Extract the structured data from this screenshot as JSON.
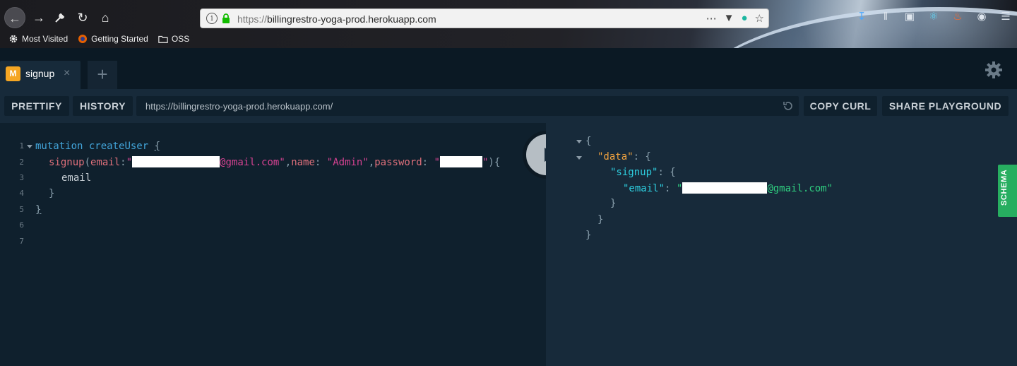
{
  "browser": {
    "url": "https://billingrestro-yoga-prod.herokuapp.com",
    "url_host_prefix": "https://",
    "url_host": "billingrestro-yoga-prod.herokuapp.com",
    "bookmarks": [
      {
        "label": "Most Visited",
        "icon": "gear-icon"
      },
      {
        "label": "Getting Started",
        "icon": "firefox-icon"
      },
      {
        "label": "OSS",
        "icon": "folder-icon"
      }
    ]
  },
  "playground": {
    "tab": {
      "badge": "M",
      "label": "signup",
      "close": "×"
    },
    "add_tab": "+",
    "buttons": {
      "prettify": "PRETTIFY",
      "history": "HISTORY",
      "copy_curl": "COPY CURL",
      "share": "SHARE PLAYGROUND"
    },
    "endpoint": "https://billingrestro-yoga-prod.herokuapp.com/",
    "schema_label": "SCHEMA",
    "line_numbers": [
      "1",
      "2",
      "3",
      "4",
      "5",
      "6",
      "7"
    ],
    "query": {
      "l1_kw": "mutation",
      "l1_name": "createUser",
      "l1_brace": "{",
      "l2_field": "signup",
      "l2_open": "(",
      "l2_arg1": "email",
      "l2_colon": ":",
      "l2_q1": "\"",
      "l2_email_suffix": "@gmail.com\"",
      "l2_comma1": ",",
      "l2_arg2": "name",
      "l2_colon2": ": ",
      "l2_name_val": "\"Admin\"",
      "l2_comma2": ",",
      "l2_arg3": "password",
      "l2_colon3": ": ",
      "l2_q3": "\"",
      "l2_q4": "\"",
      "l2_close": "){",
      "l3_field": "email",
      "l4_brace": "}",
      "l5_brace": "}"
    },
    "result": {
      "open": "{",
      "data_key": "\"data\"",
      "colon": ": {",
      "signup_key": "\"signup\"",
      "signup_colon": ": {",
      "email_key": "\"email\"",
      "email_colon": ": ",
      "email_q": "\"",
      "email_suffix": "@gmail.com\"",
      "close3": "}",
      "close2": "}",
      "close1": "}"
    },
    "colors": {
      "background": "#0f202d",
      "panel": "#172a3a",
      "keyword": "#42a4d9",
      "string": "#d64292",
      "result_key": "#2ecfe0",
      "result_string": "#2fcf80",
      "schema_tab": "#27ae60"
    }
  }
}
